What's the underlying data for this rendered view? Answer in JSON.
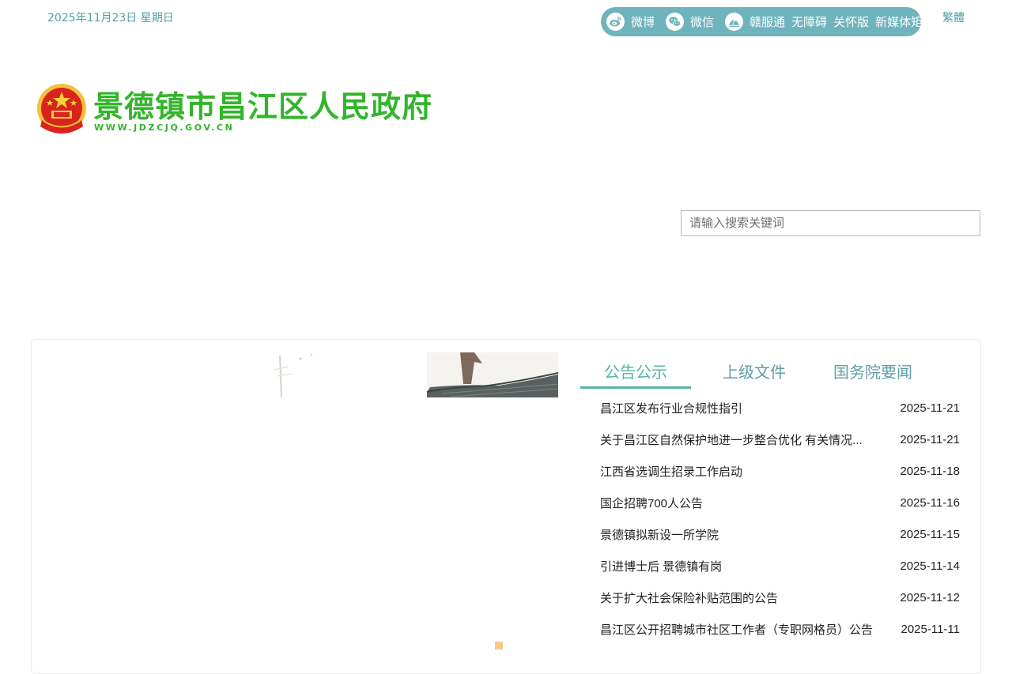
{
  "header": {
    "date": "2025年11月23日 星期日",
    "social": {
      "weibo_label": "微博",
      "wechat_label": "微信",
      "ganfutong_label": "赣服通",
      "accessibility_label": "无障碍",
      "care_label": "关怀版",
      "media_matrix_label": "新媒体矩阵"
    },
    "traditional_label": "繁體"
  },
  "logo": {
    "title": "景德镇市昌江区人民政府",
    "url_text": "WWW.JDZCJQ.GOV.CN"
  },
  "search": {
    "placeholder": "请输入搜索关键词"
  },
  "tabs": [
    {
      "label": "公告公示",
      "active": true
    },
    {
      "label": "上级文件",
      "active": false
    },
    {
      "label": "国务院要闻",
      "active": false
    }
  ],
  "news": [
    {
      "title": "昌江区发布行业合规性指引",
      "date": "2025-11-21"
    },
    {
      "title": "关于昌江区自然保护地进一步整合优化 有关情况...",
      "date": "2025-11-21"
    },
    {
      "title": "江西省选调生招录工作启动",
      "date": "2025-11-18"
    },
    {
      "title": "国企招聘700人公告",
      "date": "2025-11-16"
    },
    {
      "title": "景德镇拟新设一所学院",
      "date": "2025-11-15"
    },
    {
      "title": "引进博士后 景德镇有岗",
      "date": "2025-11-14"
    },
    {
      "title": "关于扩大社会保险补贴范围的公告",
      "date": "2025-11-12"
    },
    {
      "title": "昌江区公开招聘城市社区工作者（专职网格员）公告",
      "date": "2025-11-11"
    }
  ],
  "colors": {
    "accent_teal": "#6fb3bd",
    "title_green": "#33b52b",
    "tab_underline": "#56b3a9"
  }
}
